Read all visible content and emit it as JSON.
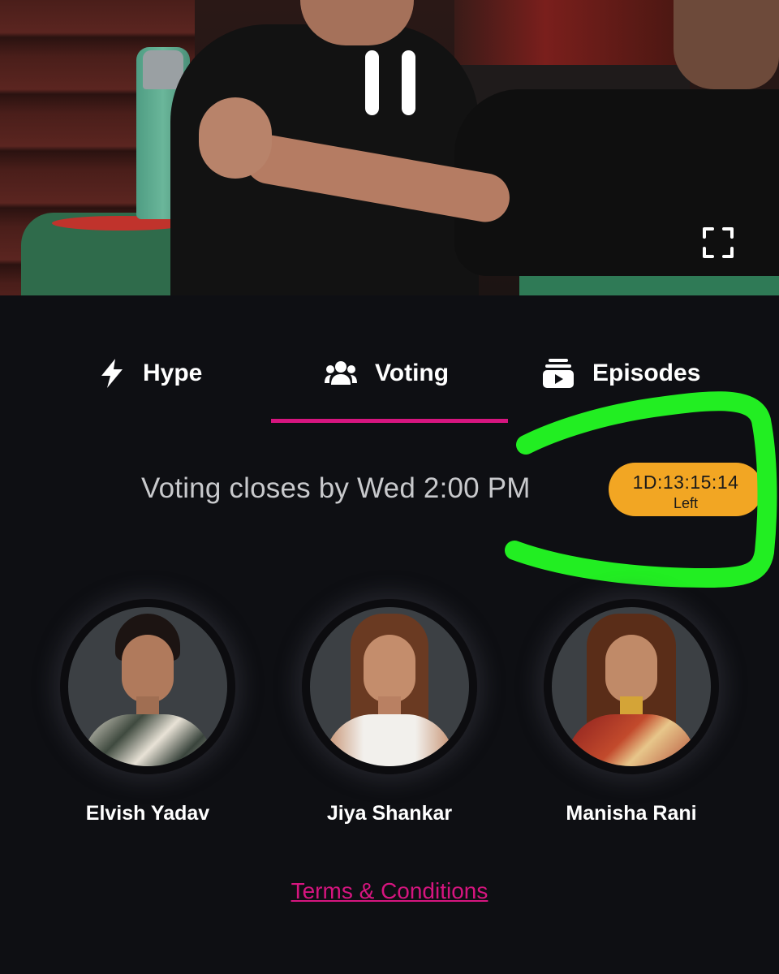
{
  "video": {
    "pause_icon": "pause-icon",
    "fullscreen_icon": "fullscreen-icon"
  },
  "tabs": [
    {
      "label": "Hype",
      "icon": "lightning-icon",
      "active": false
    },
    {
      "label": "Voting",
      "icon": "users-icon",
      "active": true
    },
    {
      "label": "Episodes",
      "icon": "episodes-icon",
      "active": false
    }
  ],
  "voting": {
    "closes_text": "Voting closes by Wed 2:00 PM",
    "countdown_time": "1D:13:15:14",
    "countdown_suffix": "Left"
  },
  "contestants": [
    {
      "name": "Elvish Yadav"
    },
    {
      "name": "Jiya Shankar"
    },
    {
      "name": "Manisha Rani"
    }
  ],
  "footer": {
    "terms_label": "Terms & Conditions"
  },
  "colors": {
    "accent": "#d6157f",
    "countdown_bg": "#f2a623",
    "background": "#0e0f13",
    "annotation_stroke": "#22ee22"
  }
}
